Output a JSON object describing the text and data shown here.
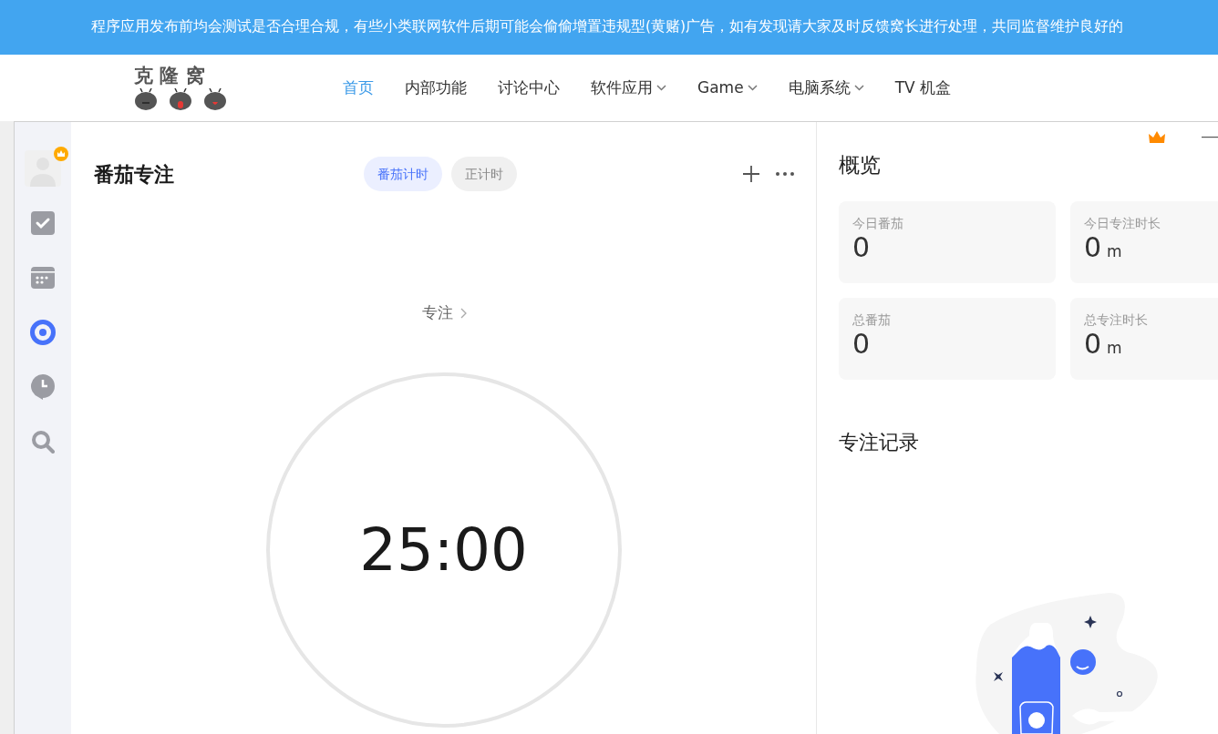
{
  "banner": {
    "text": "程序应用发布前均会测试是否合理合规，有些小类联网软件后期可能会偷偷增置违规型(黄赌)广告，如有发现请大家及时反馈窝长进行处理，共同监督维护良好的"
  },
  "site_header": {
    "logo_text": "克 隆 窝",
    "nav": [
      {
        "label": "首页",
        "selected": true,
        "has_menu": false
      },
      {
        "label": "内部功能",
        "selected": false,
        "has_menu": false
      },
      {
        "label": "讨论中心",
        "selected": false,
        "has_menu": false
      },
      {
        "label": "软件应用",
        "selected": false,
        "has_menu": true
      },
      {
        "label": "Game",
        "selected": false,
        "has_menu": true
      },
      {
        "label": "电脑系统",
        "selected": false,
        "has_menu": true
      },
      {
        "label": "TV 机盒",
        "selected": false,
        "has_menu": false
      }
    ]
  },
  "sidebar": {
    "items": [
      {
        "kind": "avatar",
        "selected": false
      },
      {
        "kind": "tasks",
        "selected": false
      },
      {
        "kind": "calendar",
        "selected": false
      },
      {
        "kind": "focus",
        "selected": true
      },
      {
        "kind": "location",
        "selected": false
      },
      {
        "kind": "search",
        "selected": false
      }
    ]
  },
  "focus": {
    "title": "番茄专注",
    "tabs": [
      {
        "label": "番茄计时",
        "selected": true
      },
      {
        "label": "正计时",
        "selected": false
      }
    ],
    "task_label": "专注",
    "time": "25:00"
  },
  "overview": {
    "title": "概览",
    "stats": [
      {
        "label": "今日番茄",
        "value": "0"
      },
      {
        "label": "今日专注时长",
        "value": "0",
        "unit": "m"
      },
      {
        "label": "总番茄",
        "value": "0"
      },
      {
        "label": "总专注时长",
        "value": "0",
        "unit": "m"
      }
    ],
    "records_title": "专注记录"
  }
}
